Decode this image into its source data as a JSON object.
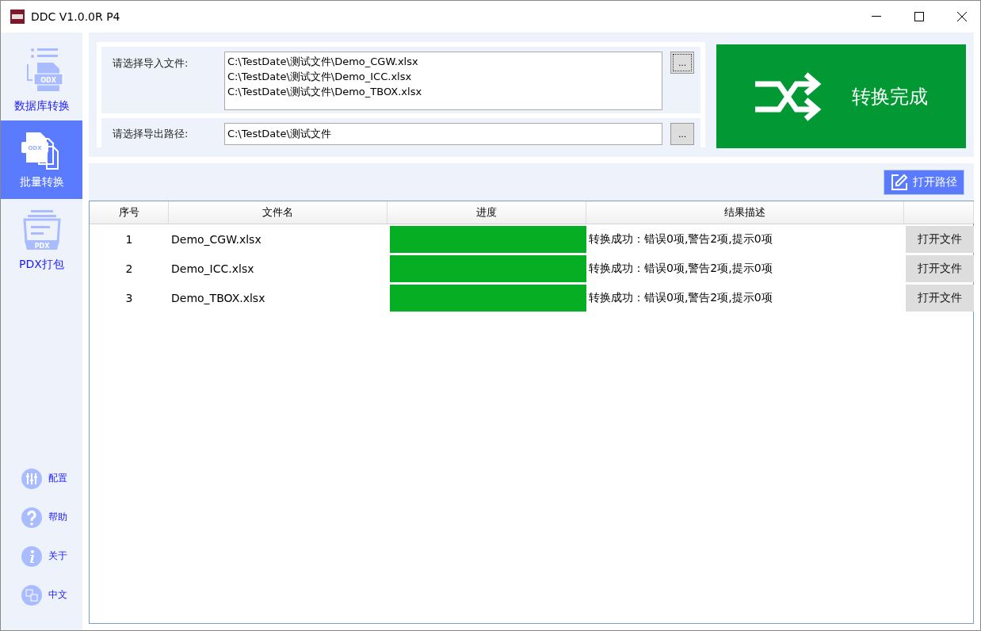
{
  "window": {
    "title": "DDC V1.0.0R P4"
  },
  "sidebar": {
    "nav": [
      {
        "label": "数据库转换",
        "selected": false,
        "icon_text": "ODX"
      },
      {
        "label": "批量转换",
        "selected": true,
        "icon_text": "ODX"
      },
      {
        "label": "PDX打包",
        "selected": false,
        "icon_text": "PDX"
      }
    ],
    "links": [
      {
        "label": "配置"
      },
      {
        "label": "帮助"
      },
      {
        "label": "关于"
      },
      {
        "label": "中文"
      }
    ]
  },
  "import": {
    "label": "请选择导入文件:",
    "files": [
      "C:\\TestDate\\测试文件\\Demo_CGW.xlsx",
      "C:\\TestDate\\测试文件\\Demo_ICC.xlsx",
      "C:\\TestDate\\测试文件\\Demo_TBOX.xlsx"
    ],
    "browse": "..."
  },
  "export": {
    "label": "请选择导出路径:",
    "value": "C:\\TestDate\\测试文件",
    "browse": "..."
  },
  "status_panel": {
    "text": "转换完成"
  },
  "open_path_button": "打开路径",
  "table": {
    "columns": [
      "序号",
      "文件名",
      "进度",
      "结果描述"
    ],
    "rows": [
      {
        "index": "1",
        "file": "Demo_CGW.xlsx",
        "level": 1,
        "result": "转换成功：错误0项,警告2项,提示0项",
        "action": "打开文件"
      },
      {
        "index": "2",
        "file": "Demo_ICC.xlsx",
        "level": 1,
        "result": "转换成功：错误0项,警告2项,提示0项",
        "action": "打开文件"
      },
      {
        "index": "3",
        "file": "Demo_TBOX.xlsx",
        "level": 1,
        "result": "转换成功：错误0项,警告2项,提示0项",
        "action": "打开文件"
      }
    ]
  }
}
